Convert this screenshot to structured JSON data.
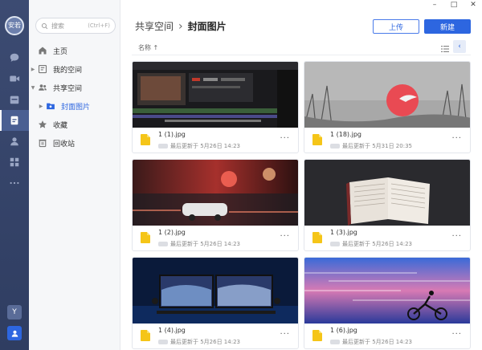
{
  "rail": {
    "avatar_text": "安若",
    "bottom_badge": "Y"
  },
  "sidebar": {
    "search_placeholder": "搜索",
    "search_shortcut": "(Ctrl+F)",
    "items": [
      {
        "label": "主页"
      },
      {
        "label": "我的空间"
      },
      {
        "label": "共享空间"
      },
      {
        "label": "封面图片"
      },
      {
        "label": "收藏"
      },
      {
        "label": "回收站"
      }
    ]
  },
  "header": {
    "breadcrumb_parent": "共享空间",
    "breadcrumb_current": "封面图片",
    "upload_label": "上传",
    "new_label": "新建",
    "sort_label": "名称 ↑"
  },
  "files": [
    {
      "name": "1 (1).jpg",
      "meta": "最后更新于 5月26日 14:23"
    },
    {
      "name": "1 (18).jpg",
      "meta": "最后更新于 5月31日 20:35"
    },
    {
      "name": "1 (2).jpg",
      "meta": "最后更新于 5月26日 14:23"
    },
    {
      "name": "1 (3).jpg",
      "meta": "最后更新于 5月26日 14:23"
    },
    {
      "name": "1 (4).jpg",
      "meta": "最后更新于 5月26日 14:23"
    },
    {
      "name": "1 (6).jpg",
      "meta": "最后更新于 5月26日 14:23"
    }
  ],
  "colors": {
    "accent": "#2d66e0",
    "rail": "#34426a"
  }
}
